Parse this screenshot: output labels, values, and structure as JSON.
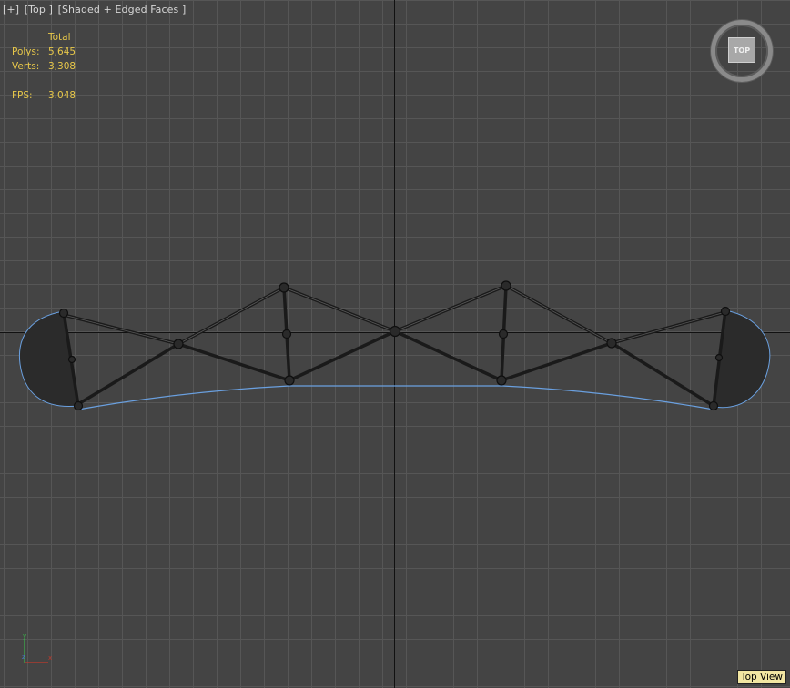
{
  "viewport": {
    "label_parts": [
      "[+]",
      "[Top ]",
      "[Shaded + Edged Faces ]"
    ],
    "corner_label": "Top View",
    "viewcube_face": "TOP"
  },
  "stats": {
    "header": "Total",
    "polys_key": "Polys:",
    "polys_value": "5,645",
    "verts_key": "Verts:",
    "verts_value": "3,308",
    "fps_key": "FPS:",
    "fps_value": "3.048"
  },
  "icons": {
    "viewcube": "viewcube-icon",
    "axis_tripod": "axis-tripod-icon"
  },
  "colors": {
    "grid_bg": "#444444",
    "grid_lines": "#565656",
    "stats_text": "#e8c84a",
    "selection_curve": "#6aa0e0",
    "truss_members": "#1a1a1a"
  }
}
